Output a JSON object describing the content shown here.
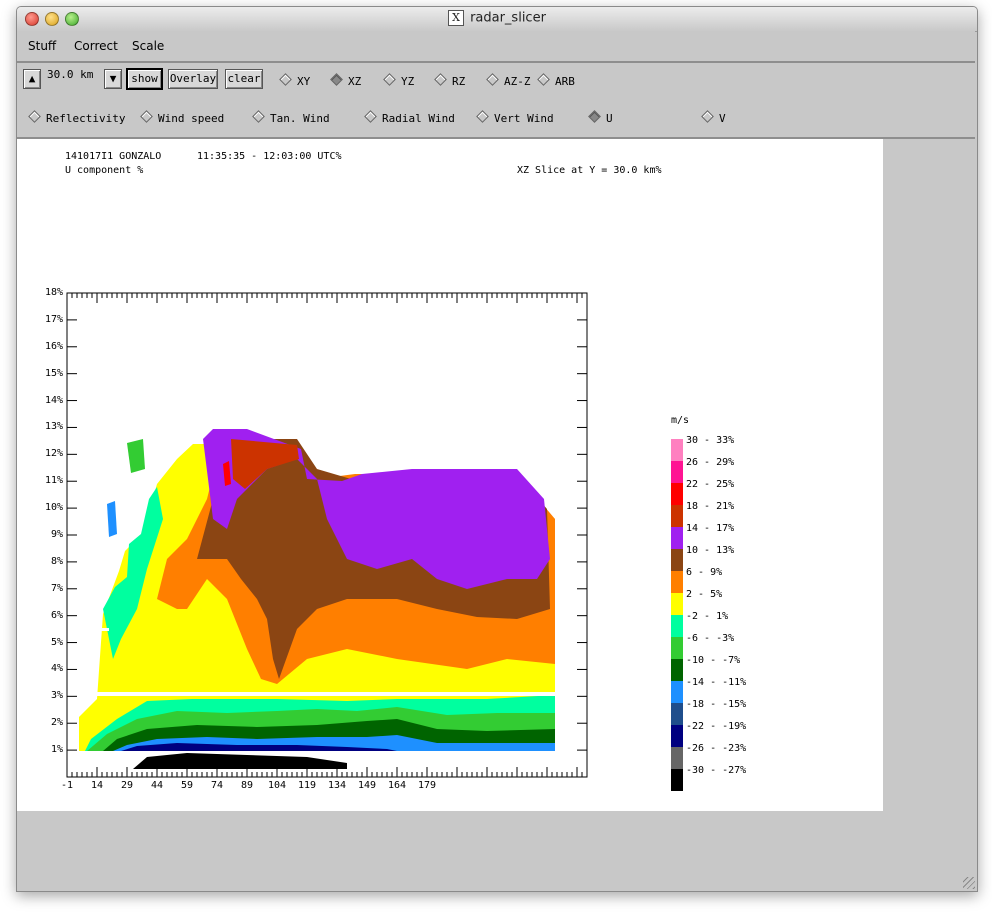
{
  "window": {
    "title": "radar_slicer"
  },
  "menubar": {
    "items": [
      "Stuff",
      "Correct",
      "Scale"
    ]
  },
  "toolbar": {
    "up_arrow": "▲",
    "down_arrow": "▼",
    "height_value": "30.0 km",
    "show_label": "show",
    "overlay_label": "Overlay",
    "clear_label": "clear",
    "view_options": [
      {
        "label": "XY",
        "selected": false
      },
      {
        "label": "XZ",
        "selected": true
      },
      {
        "label": "YZ",
        "selected": false
      },
      {
        "label": "RZ",
        "selected": false
      },
      {
        "label": "AZ-Z",
        "selected": false
      },
      {
        "label": "ARB",
        "selected": false
      }
    ],
    "field_options": [
      {
        "label": "Reflectivity",
        "selected": false
      },
      {
        "label": "Wind speed",
        "selected": false
      },
      {
        "label": "Tan. Wind",
        "selected": false
      },
      {
        "label": "Radial Wind",
        "selected": false
      },
      {
        "label": "Vert Wind",
        "selected": false
      },
      {
        "label": "U",
        "selected": true
      },
      {
        "label": "V",
        "selected": false
      }
    ]
  },
  "plot": {
    "date_storm": "141017I1 GONZALO",
    "time_range": "11:35:35 - 12:03:00 UTC%",
    "component": "U component %",
    "slice": "XZ Slice at Y = 30.0 km%",
    "y_ticks": [
      "18%",
      "17%",
      "16%",
      "15%",
      "14%",
      "13%",
      "12%",
      "11%",
      "10%",
      "9%",
      "8%",
      "7%",
      "6%",
      "5%",
      "4%",
      "3%",
      "2%",
      "1%"
    ],
    "x_ticks": [
      "-1",
      "14",
      "29",
      "44",
      "59",
      "74",
      "89",
      "104",
      "119",
      "134",
      "149",
      "164",
      "179"
    ]
  },
  "legend": {
    "title": "m/s",
    "entries": [
      {
        "label": "30 - 33%",
        "color": "#ff80c0"
      },
      {
        "label": "26 - 29%",
        "color": "#ff1493"
      },
      {
        "label": "22 - 25%",
        "color": "#ff0000"
      },
      {
        "label": "18 - 21%",
        "color": "#cc3300"
      },
      {
        "label": "14 - 17%",
        "color": "#a020f0"
      },
      {
        "label": "10 - 13%",
        "color": "#8b4513"
      },
      {
        "label": "6 - 9%",
        "color": "#ff7f00"
      },
      {
        "label": "2 - 5%",
        "color": "#ffff00"
      },
      {
        "label": "-2 - 1%",
        "color": "#00ff9f"
      },
      {
        "label": "-6 - -3%",
        "color": "#33cc33"
      },
      {
        "label": "-10 - -7%",
        "color": "#006400"
      },
      {
        "label": "-14 - -11%",
        "color": "#1e90ff"
      },
      {
        "label": "-18 - -15%",
        "color": "#1f4e8c"
      },
      {
        "label": "-22 - -19%",
        "color": "#000080"
      },
      {
        "label": "-26 - -23%",
        "color": "#666666"
      },
      {
        "label": "-30 - -27%",
        "color": "#000000"
      }
    ]
  }
}
